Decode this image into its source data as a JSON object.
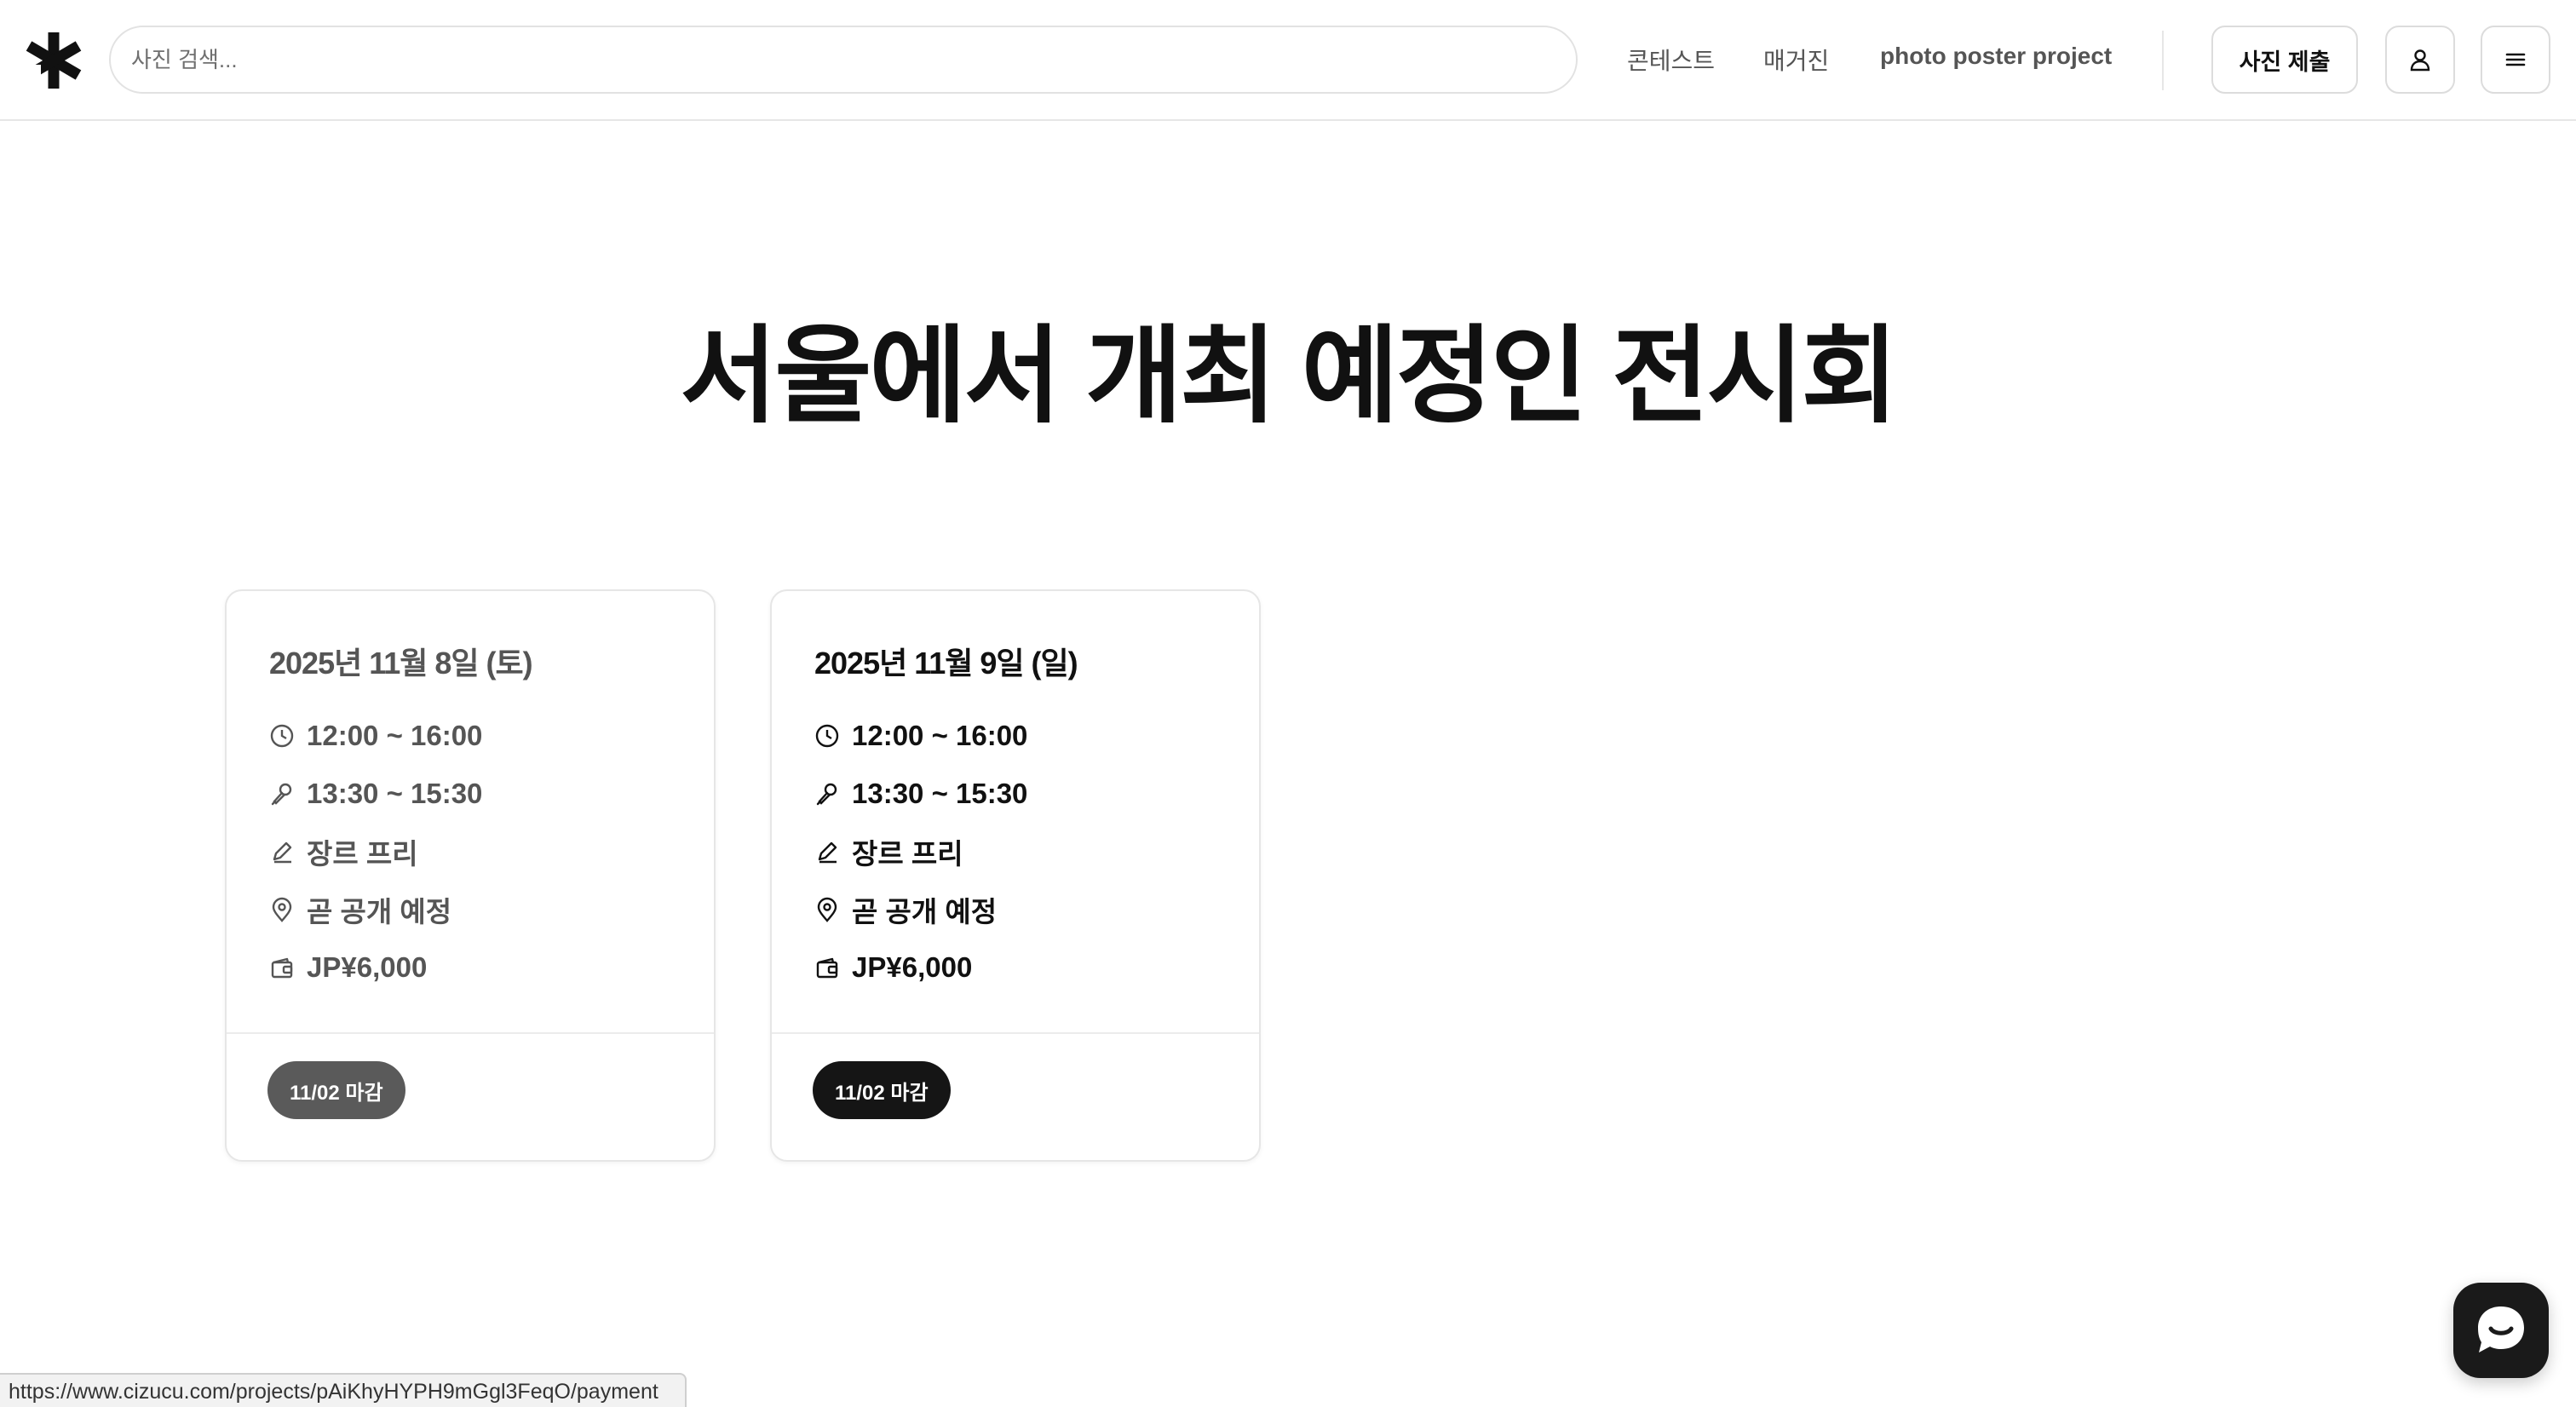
{
  "header": {
    "search_placeholder": "사진 검색...",
    "nav": [
      "콘테스트",
      "매거진",
      "photo poster project"
    ],
    "submit_label": "사진 제출"
  },
  "page": {
    "title": "서울에서 개최 예정인 전시회"
  },
  "events": [
    {
      "date": "2025년 11월 8일 (토)",
      "hours": "12:00 ~ 16:00",
      "session": "13:30 ~ 15:30",
      "genre": "장르 프리",
      "venue": "곧 공개 예정",
      "price": "JP¥6,000",
      "deadline": "11/02 마감"
    },
    {
      "date": "2025년 11월 9일 (일)",
      "hours": "12:00 ~ 16:00",
      "session": "13:30 ~ 15:30",
      "genre": "장르 프리",
      "venue": "곧 공개 예정",
      "price": "JP¥6,000",
      "deadline": "11/02 마감"
    }
  ],
  "status_bar": {
    "url": "https://www.cizucu.com/projects/pAiKhyHYPH9mGgl3FeqO/payment"
  },
  "icons": {
    "logo": "asterisk-logo-icon",
    "user": "user-icon",
    "menu": "menu-icon",
    "time": "clock-icon",
    "session": "microphone-icon",
    "genre": "pencil-icon",
    "venue": "map-pin-icon",
    "price": "wallet-icon",
    "chat": "chat-bubble-icon"
  },
  "colors": {
    "badge_dim": "#5a5a5a",
    "badge_active": "#151515",
    "chat": "#1a1a1a"
  }
}
